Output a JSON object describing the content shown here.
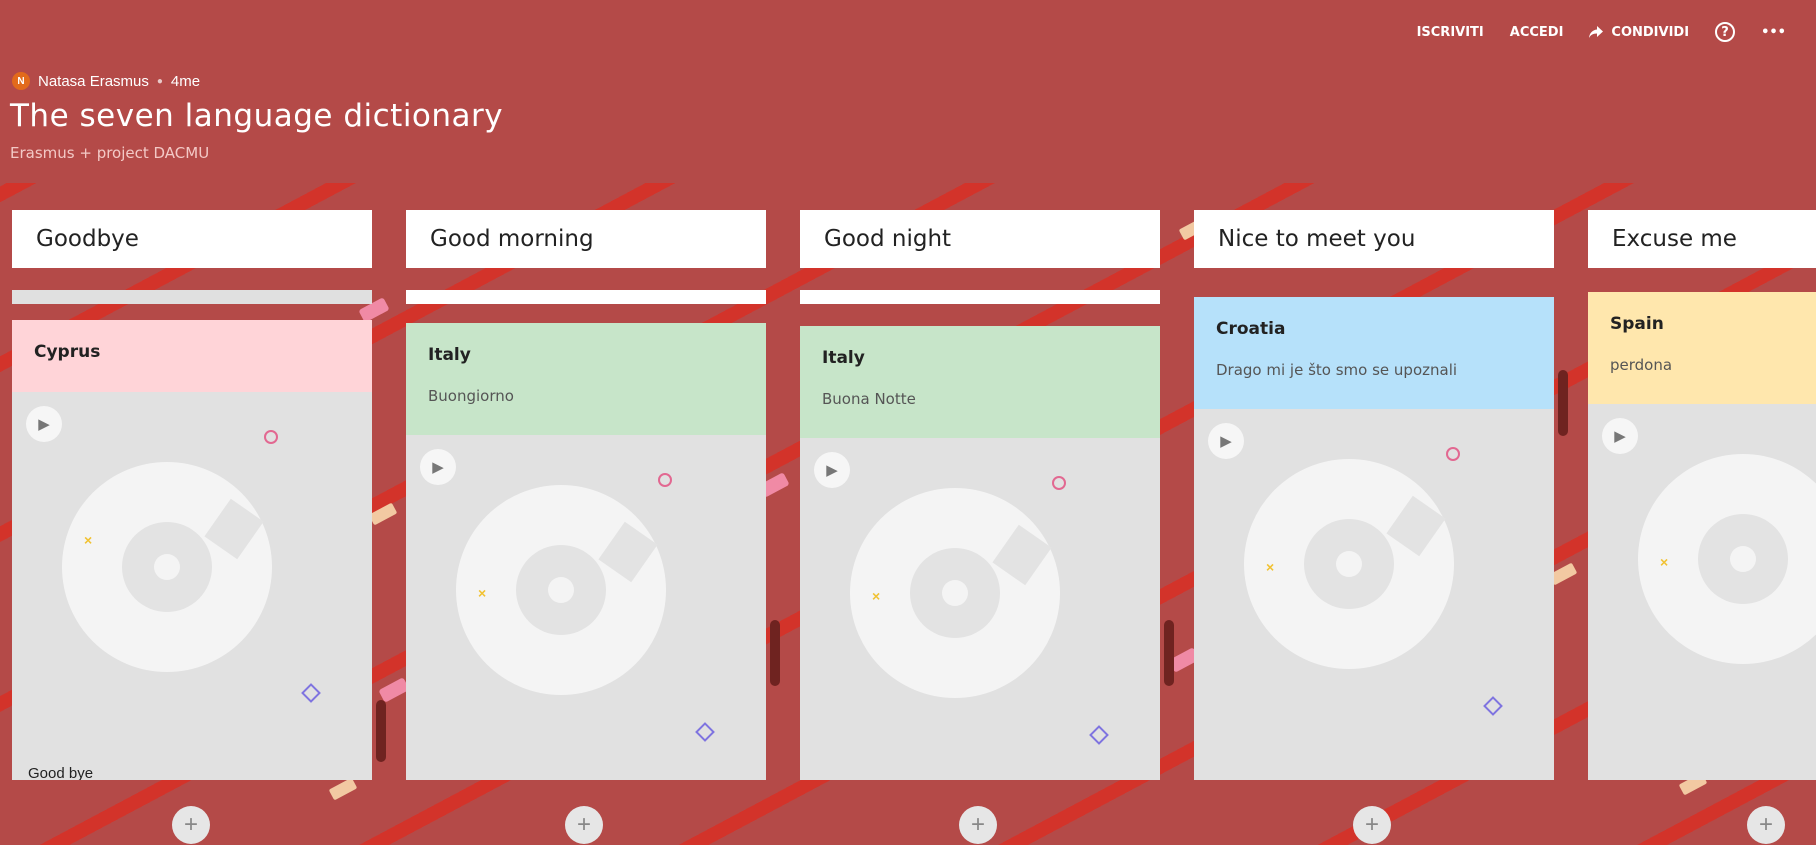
{
  "topbar": {
    "signup": "ISCRIVITI",
    "login": "ACCEDI",
    "share": "CONDIVIDI",
    "share_icon": "share-arrow-icon",
    "help_icon": "?",
    "more_icon": "•••"
  },
  "author": {
    "initial": "N",
    "name": "Natasa Erasmus",
    "time": "4me"
  },
  "board": {
    "title": "The seven language dictionary",
    "subtitle": "Erasmus + project DACMU"
  },
  "columns": [
    {
      "title": "Goodbye",
      "card": {
        "country": "Cyprus",
        "text": "",
        "color": "#ffd4d8",
        "caption": "Good bye"
      }
    },
    {
      "title": "Good morning",
      "card": {
        "country": "Italy",
        "text": "Buongiorno",
        "color": "#c7e5c9"
      }
    },
    {
      "title": "Good night",
      "card": {
        "country": "Italy",
        "text": "Buona Notte",
        "color": "#c7e5c9"
      }
    },
    {
      "title": "Nice to meet you",
      "card": {
        "country": "Croatia",
        "text": "Drago mi je što smo se upoznali",
        "color": "#b6e1fa"
      }
    },
    {
      "title": "Excuse me",
      "card": {
        "country": "Spain",
        "text": "perdona",
        "color": "#ffe7ad"
      }
    }
  ],
  "add_label": "+",
  "play_label": "▶"
}
